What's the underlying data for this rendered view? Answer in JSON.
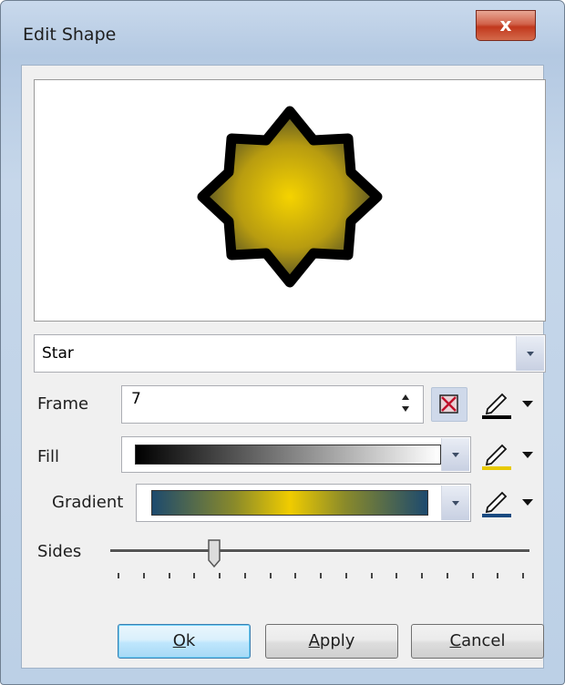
{
  "window": {
    "title": "Edit Shape",
    "close_glyph": "x"
  },
  "shape_combo": {
    "selected": "Star"
  },
  "frame": {
    "label": "Frame",
    "value": "7",
    "icons": [
      "spin-up-down-icon",
      "no-color-icon",
      "pen-color-icon"
    ],
    "pen_color": "#000000"
  },
  "fill": {
    "label": "Fill",
    "pen_color": "#e8c900",
    "gradient_colors": [
      "#000000",
      "#ffffff"
    ]
  },
  "gradient": {
    "label": "Gradient",
    "pen_color": "#1a4a80",
    "gradient_colors": [
      "#1d4a6e",
      "#f0cc00",
      "#1d4a6e"
    ]
  },
  "sides": {
    "label": "Sides",
    "level_fraction": 0.25,
    "tick_count": 17
  },
  "buttons": {
    "ok": {
      "label": "Ok",
      "mnemonic": "O",
      "rest": "k"
    },
    "apply": {
      "label": "Apply",
      "mnemonic": "A",
      "rest": "pply"
    },
    "cancel": {
      "label": "Cancel",
      "mnemonic": "C",
      "rest": "ancel"
    }
  },
  "preview": {
    "shape": "8-point star",
    "fill_colors": [
      "#f5d300",
      "#3a3d2a"
    ],
    "frame_color": "#000000"
  }
}
